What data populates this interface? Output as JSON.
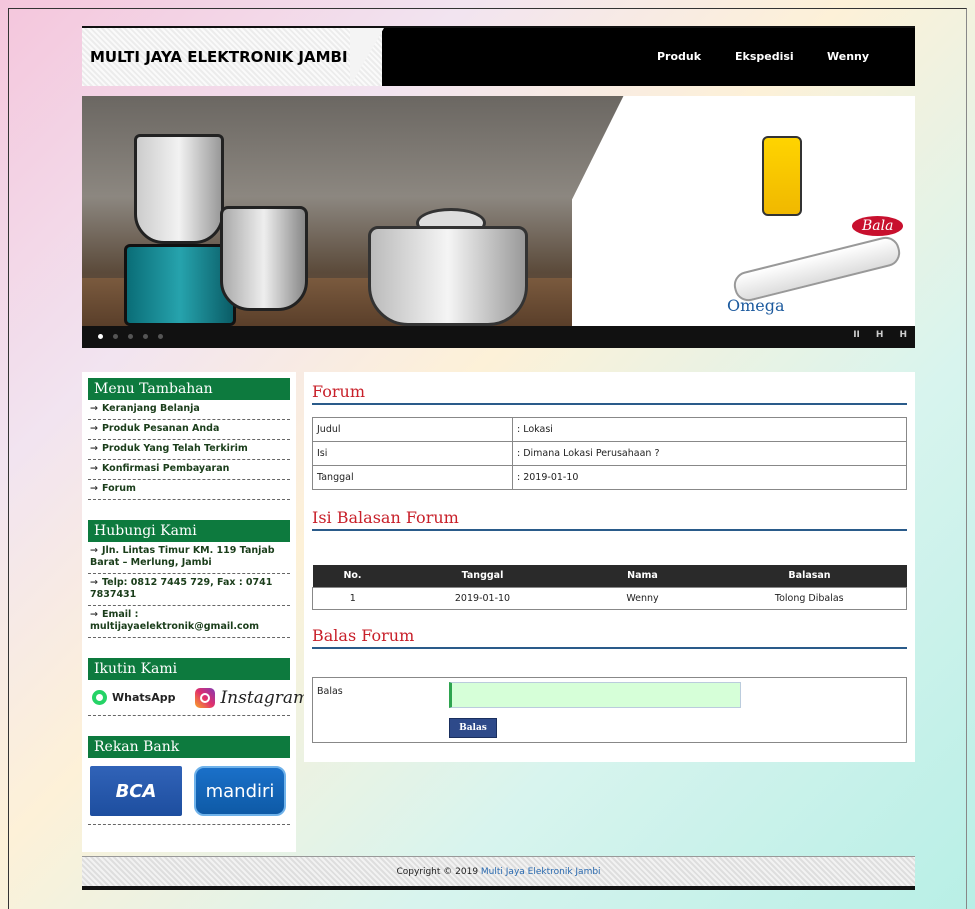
{
  "header": {
    "brand": "MULTI JAYA ELEKTRONIK JAMBI",
    "nav": [
      "Produk",
      "Ekspedisi",
      "Wenny"
    ]
  },
  "banner": {
    "logos": {
      "bala": "Bala",
      "omega": "Omega"
    },
    "slide_count": 5,
    "active_slide": 1,
    "controls": {
      "pause": "II",
      "prev": "H",
      "next": "H"
    }
  },
  "sidebar": {
    "menu_title": "Menu Tambahan",
    "menu_items": [
      "Keranjang Belanja",
      "Produk Pesanan Anda",
      "Produk Yang Telah Terkirim",
      "Konfirmasi Pembayaran",
      "Forum"
    ],
    "contact_title": "Hubungi Kami",
    "contact_items": [
      "Jln. Lintas Timur KM. 119 Tanjab Barat – Merlung, Jambi",
      "Telp: 0812 7445 729, Fax : 0741 7837431",
      "Email : multijayaelektronik@gmail.com"
    ],
    "follow_title": "Ikutin Kami",
    "whatsapp": "WhatsApp",
    "instagram": "Instagram",
    "bank_title": "Rekan Bank",
    "banks": [
      "BCA",
      "mandiri"
    ]
  },
  "forum": {
    "title": "Forum",
    "rows": [
      {
        "key": "Judul",
        "value": ": Lokasi"
      },
      {
        "key": "Isi",
        "value": ": Dimana Lokasi Perusahaan ?"
      },
      {
        "key": "Tanggal",
        "value": ": 2019-01-10"
      }
    ]
  },
  "replies": {
    "title": "Isi Balasan Forum",
    "columns": [
      "No.",
      "Tanggal",
      "Nama",
      "Balasan"
    ],
    "rows": [
      [
        "1",
        "2019-01-10",
        "Wenny",
        "Tolong Dibalas"
      ]
    ]
  },
  "reply_form": {
    "title": "Balas Forum",
    "label": "Balas",
    "value": "",
    "button": "Balas"
  },
  "footer": {
    "text": "Copyright © 2019",
    "link": "Multi Jaya Elektronik Jambi"
  },
  "colors": {
    "sidebar_header": "#0d7a3e",
    "section_title": "#c8202a",
    "section_rule": "#2a5b8a",
    "table_head": "#2a2a2a",
    "button": "#2e4a8a",
    "textarea": "#d6ffd8"
  }
}
